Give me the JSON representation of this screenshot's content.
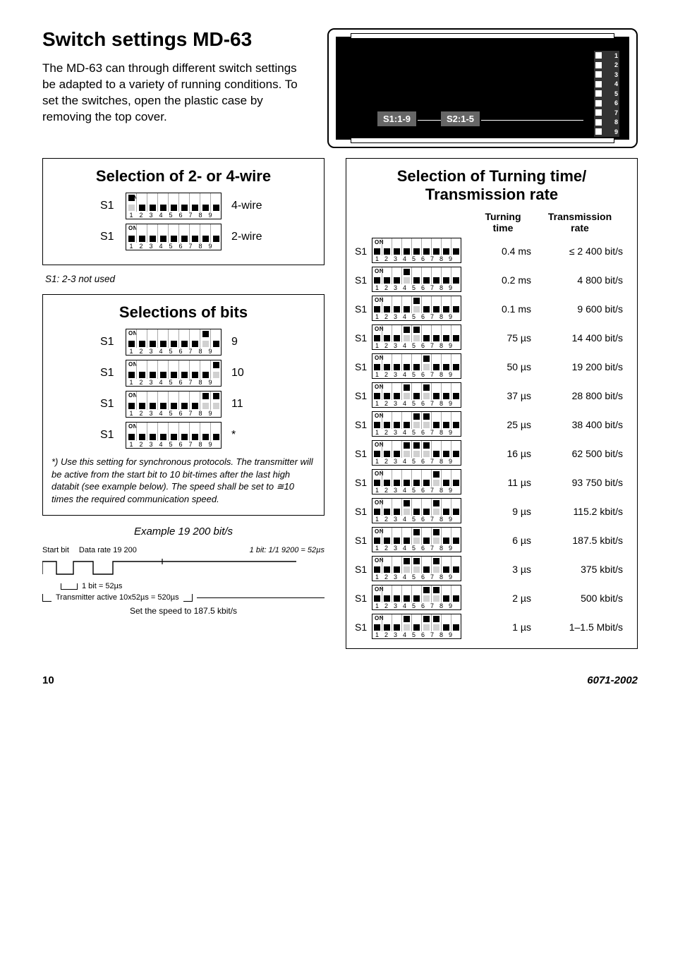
{
  "title": "Switch settings MD-63",
  "intro": "The MD-63 can through different switch settings be adapted to a variety of running conditions. To set the switches, open the plastic case by removing the top cover.",
  "device": {
    "label1": "S1:1-9",
    "label2": "S2:1-5"
  },
  "wire": {
    "heading": "Selection of 2- or 4-wire",
    "rows": [
      {
        "name": "S1",
        "label": "4-wire",
        "on": [
          1
        ]
      },
      {
        "name": "S1",
        "label": "2-wire",
        "on": []
      }
    ],
    "note": "S1: 2-3 not used"
  },
  "bits": {
    "heading": "Selections of bits",
    "rows": [
      {
        "name": "S1",
        "label": "9",
        "on": [
          8
        ]
      },
      {
        "name": "S1",
        "label": "10",
        "on": [
          9
        ]
      },
      {
        "name": "S1",
        "label": "11",
        "on": [
          8,
          9
        ]
      },
      {
        "name": "S1",
        "label": "*",
        "on": []
      }
    ],
    "footnote": "*) Use this setting for synchronous protocols. The transmitter will be active from the start bit to 10 bit-times after the last high databit (see example below). The speed shall be set to ≅10 times the required communication speed."
  },
  "example": {
    "title": "Example 19 200 bit/s",
    "labels": [
      "Start bit",
      "Data rate 19 200"
    ],
    "rightnote": "1 bit: 1/1 9200 = 52µs",
    "bitnote": "1 bit = 52µs",
    "txnote": "Transmitter active   10x52µs = 520µs",
    "caption": "Set the speed to 187.5 kbit/s"
  },
  "rate": {
    "heading": "Selection of Turning time/ Transmission rate",
    "head": {
      "c2a": "Turning",
      "c2b": "time",
      "c3a": "Transmission",
      "c3b": "rate"
    },
    "rows": [
      {
        "name": "S1",
        "on": [],
        "time": "0.4 ms",
        "rate": "≤ 2 400 bit/s"
      },
      {
        "name": "S1",
        "on": [
          4
        ],
        "time": "0.2 ms",
        "rate": "4 800 bit/s"
      },
      {
        "name": "S1",
        "on": [
          5
        ],
        "time": "0.1 ms",
        "rate": "9 600 bit/s"
      },
      {
        "name": "S1",
        "on": [
          4,
          5
        ],
        "time": "75 µs",
        "rate": "14 400 bit/s"
      },
      {
        "name": "S1",
        "on": [
          6
        ],
        "time": "50 µs",
        "rate": "19 200 bit/s"
      },
      {
        "name": "S1",
        "on": [
          4,
          6
        ],
        "time": "37 µs",
        "rate": "28 800 bit/s"
      },
      {
        "name": "S1",
        "on": [
          5,
          6
        ],
        "time": "25 µs",
        "rate": "38 400 bit/s"
      },
      {
        "name": "S1",
        "on": [
          4,
          5,
          6
        ],
        "time": "16 µs",
        "rate": "62 500 bit/s"
      },
      {
        "name": "S1",
        "on": [
          7
        ],
        "time": "11 µs",
        "rate": "93 750 bit/s"
      },
      {
        "name": "S1",
        "on": [
          4,
          7
        ],
        "time": "9 µs",
        "rate": "115.2 kbit/s"
      },
      {
        "name": "S1",
        "on": [
          5,
          7
        ],
        "time": "6 µs",
        "rate": "187.5 kbit/s"
      },
      {
        "name": "S1",
        "on": [
          4,
          5,
          7
        ],
        "time": "3 µs",
        "rate": "375 kbit/s"
      },
      {
        "name": "S1",
        "on": [
          6,
          7
        ],
        "time": "2 µs",
        "rate": "500 kbit/s"
      },
      {
        "name": "S1",
        "on": [
          4,
          6,
          7
        ],
        "time": "1 µs",
        "rate": "1–1.5 Mbit/s"
      }
    ]
  },
  "footer": {
    "page": "10",
    "docno": "6071-2002"
  }
}
